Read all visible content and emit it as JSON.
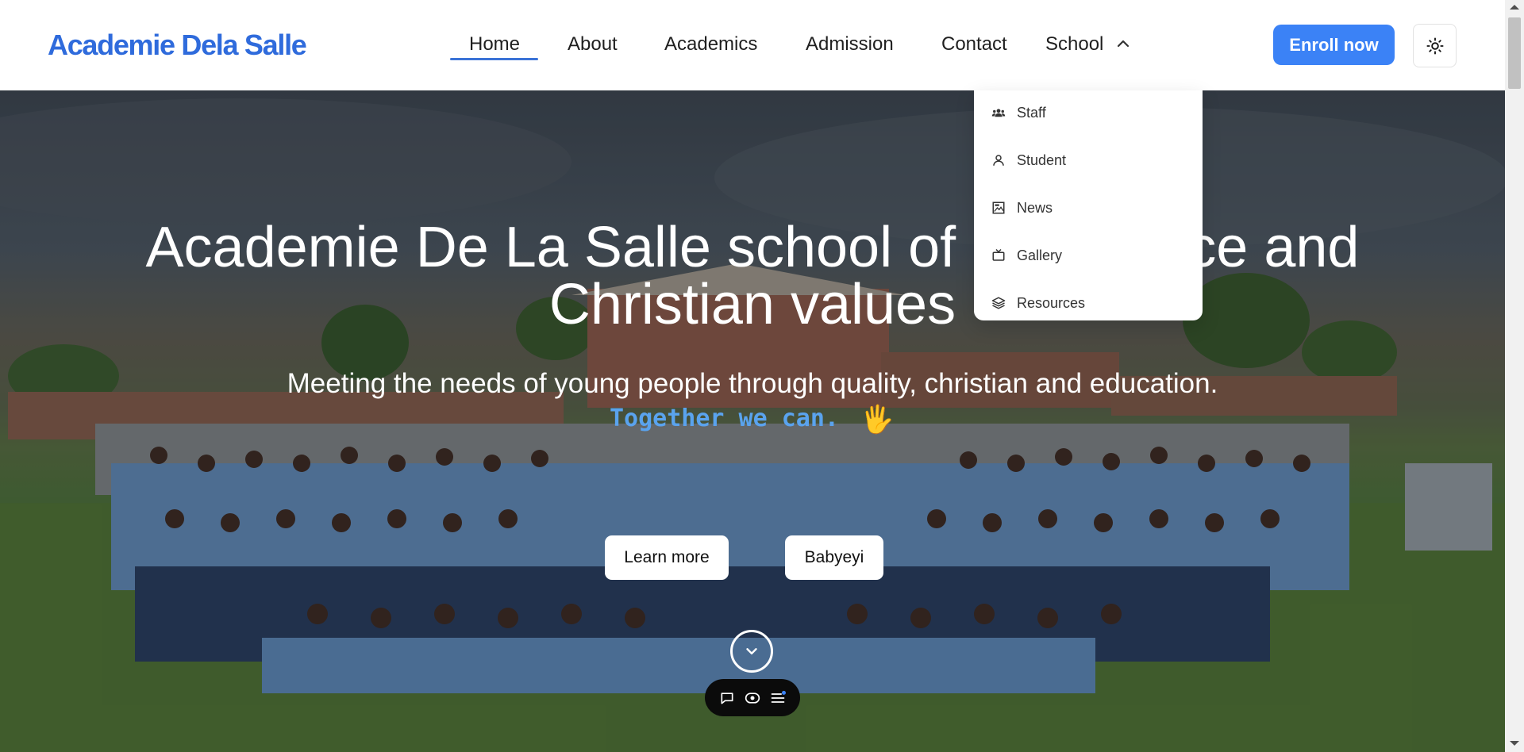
{
  "brand": {
    "name": "Academie Dela Salle",
    "color": "#2f6bdc"
  },
  "nav": {
    "home": "Home",
    "about": "About",
    "academics": "Academics",
    "admission": "Admission",
    "contact": "Contact",
    "school": "School",
    "active": "Home"
  },
  "header": {
    "enroll_label": "Enroll now",
    "theme_icon": "sun-icon"
  },
  "school_menu": {
    "expanded": true,
    "items": [
      {
        "label": "Staff",
        "icon": "users-icon"
      },
      {
        "label": "Student",
        "icon": "user-icon"
      },
      {
        "label": "News",
        "icon": "image-icon"
      },
      {
        "label": "Gallery",
        "icon": "tv-icon"
      },
      {
        "label": "Resources",
        "icon": "layers-icon"
      }
    ]
  },
  "hero": {
    "title_line1": "Academie De La Salle school of Excellence and",
    "title_line2": "Christian values",
    "subtitle": "Meeting the needs of young people through quality, christian and education.",
    "tagline": "Together we can.",
    "tagline_emoji": "🖐",
    "learn_more": "Learn more",
    "babyeyi": "Babyeyi",
    "scroll_icon": "chevron-down-icon"
  },
  "floating_toolbar": {
    "icons": [
      "chat-icon",
      "eye-icon",
      "menu-icon"
    ]
  },
  "colors": {
    "accent": "#3b82f6",
    "tagline": "#5aa3ee"
  }
}
